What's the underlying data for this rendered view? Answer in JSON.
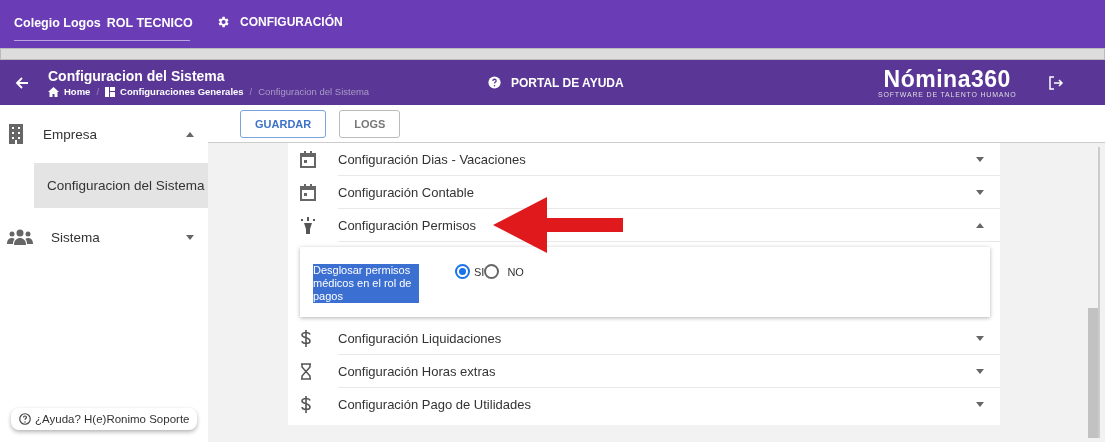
{
  "top_bar": {
    "company": "Colegio Logos",
    "role": "ROL TECNICO",
    "config_link": "CONFIGURACIÓN"
  },
  "header": {
    "title": "Configuracion del Sistema",
    "breadcrumbs": [
      {
        "label": "Home"
      },
      {
        "separator": "/",
        "label": "Configuraciones Generales"
      },
      {
        "separator": "/",
        "label": "Configuracion del Sistema"
      }
    ],
    "help_link": "PORTAL DE AYUDA",
    "logo": "Nómina360",
    "logo_tagline": "SOFTWARE DE TALENTO HUMANO"
  },
  "sidebar": {
    "items": [
      {
        "label": "Empresa",
        "expanded": true,
        "children": [
          {
            "label": "Configuracion del Sistema",
            "selected": true
          }
        ]
      },
      {
        "label": "Sistema",
        "expanded": false
      }
    ],
    "help_button": "¿Ayuda? H(e)Ronimo Soporte"
  },
  "toolbar": {
    "buttons": [
      {
        "label": "GUARDAR",
        "kind": "primary"
      },
      {
        "label": "LOGS",
        "kind": "plain"
      }
    ]
  },
  "sections": [
    {
      "label": "Configuración Dias - Vacaciones",
      "expanded": false
    },
    {
      "label": "Configuración Contable",
      "expanded": false
    },
    {
      "label": "Configuración Permisos",
      "expanded": true,
      "settings": [
        {
          "label": "Desglosar permisos médicos en el rol de pagos",
          "selected": true,
          "options": [
            {
              "label": "SI",
              "selected": true
            },
            {
              "label": "NO",
              "selected": false
            }
          ]
        }
      ]
    },
    {
      "label": "Configuración Liquidaciones",
      "expanded": false
    },
    {
      "label": "Configuración Horas extras",
      "expanded": false
    },
    {
      "label": "Configuración Pago de Utilidades",
      "expanded": false
    }
  ]
}
